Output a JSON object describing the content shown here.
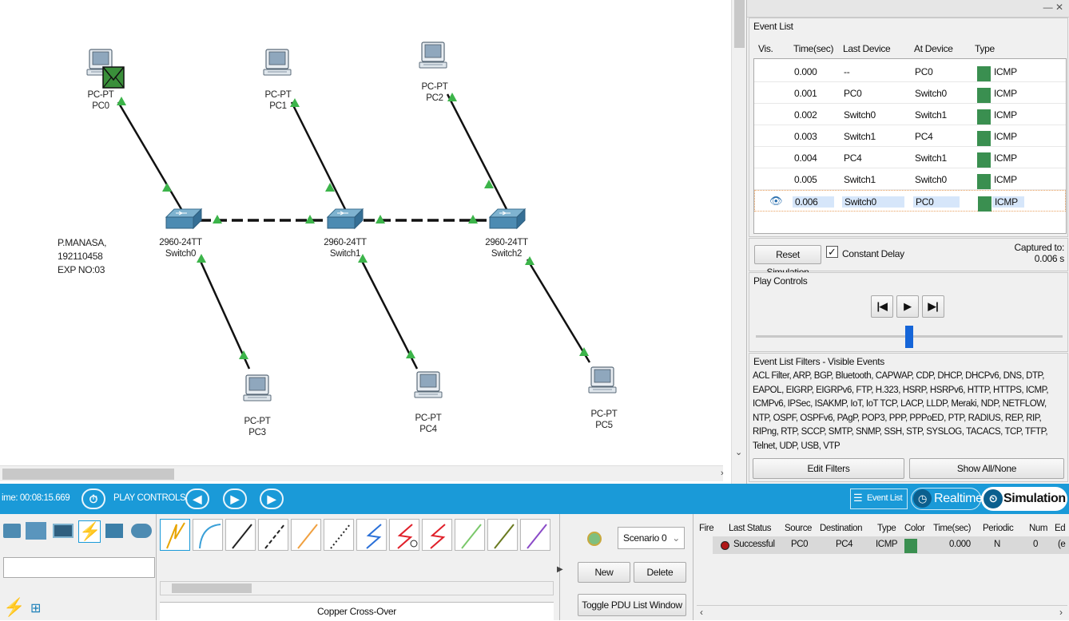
{
  "canvas": {
    "devices": [
      {
        "id": "pc0",
        "model": "PC-PT",
        "name": "PC0",
        "has_pdu": true
      },
      {
        "id": "pc1",
        "model": "PC-PT",
        "name": "PC1"
      },
      {
        "id": "pc2",
        "model": "PC-PT",
        "name": "PC2"
      },
      {
        "id": "pc3",
        "model": "PC-PT",
        "name": "PC3"
      },
      {
        "id": "pc4",
        "model": "PC-PT",
        "name": "PC4"
      },
      {
        "id": "pc5",
        "model": "PC-PT",
        "name": "PC5"
      },
      {
        "id": "sw0",
        "model": "2960-24TT",
        "name": "Switch0"
      },
      {
        "id": "sw1",
        "model": "2960-24TT",
        "name": "Switch1"
      },
      {
        "id": "sw2",
        "model": "2960-24TT",
        "name": "Switch2"
      }
    ],
    "note": [
      "P.MANASA,",
      "192110458",
      "EXP NO:03"
    ],
    "link_color": "#111111",
    "link_light_color": "#3cb44a"
  },
  "event_list": {
    "title": "Event List",
    "columns": [
      "Vis.",
      "Time(sec)",
      "Last Device",
      "At Device",
      "Type"
    ],
    "rows": [
      {
        "time": "0.000",
        "last": "--",
        "at": "PC0",
        "type": "ICMP"
      },
      {
        "time": "0.001",
        "last": "PC0",
        "at": "Switch0",
        "type": "ICMP"
      },
      {
        "time": "0.002",
        "last": "Switch0",
        "at": "Switch1",
        "type": "ICMP"
      },
      {
        "time": "0.003",
        "last": "Switch1",
        "at": "PC4",
        "type": "ICMP"
      },
      {
        "time": "0.004",
        "last": "PC4",
        "at": "Switch1",
        "type": "ICMP"
      },
      {
        "time": "0.005",
        "last": "Switch1",
        "at": "Switch0",
        "type": "ICMP"
      },
      {
        "time": "0.006",
        "last": "Switch0",
        "at": "PC0",
        "type": "ICMP",
        "selected": true
      }
    ],
    "icmp_color": "#3a8f50",
    "reset_label": "Reset Simulation",
    "constant_delay_label": "Constant Delay",
    "constant_delay_checked": true,
    "captured_label": "Captured to:",
    "captured_value": "0.006 s"
  },
  "play_controls": {
    "title": "Play Controls",
    "back_icon": "|◀",
    "play_icon": "▶",
    "forward_icon": "▶|",
    "slider_level": 0.5
  },
  "filters": {
    "title": "Event List Filters - Visible Events",
    "text": "ACL Filter, ARP, BGP, Bluetooth, CAPWAP, CDP, DHCP, DHCPv6, DNS, DTP, EAPOL, EIGRP, EIGRPv6, FTP, H.323, HSRP, HSRPv6, HTTP, HTTPS, ICMP, ICMPv6, IPSec, ISAKMP, IoT, IoT TCP, LACP, LLDP, Meraki, NDP, NETFLOW, NTP, OSPF, OSPFv6, PAgP, POP3, PPP, PPPoED, PTP, RADIUS, REP, RIP, RIPng, RTP, SCCP, SMTP, SNMP, SSH, STP, SYSLOG, TACACS, TCP, TFTP, Telnet, UDP, USB, VTP",
    "edit_label": "Edit Filters",
    "show_label": "Show All/None"
  },
  "statusbar": {
    "time": "ime: 00:08:15.669",
    "play_controls_label": "PLAY CONTROLS:",
    "event_list_label": "Event List",
    "realtime_label": "Realtime",
    "simulation_label": "Simulation",
    "accent": "#1a9ad8"
  },
  "bottom": {
    "cable_name": "Copper Cross-Over",
    "scenario": "Scenario 0",
    "new_label": "New",
    "delete_label": "Delete",
    "toggle_label": "Toggle PDU List Window",
    "pdu_columns": [
      "Fire",
      "Last Status",
      "Source",
      "Destination",
      "Type",
      "Color",
      "Time(sec)",
      "Periodic",
      "Num",
      "Ed"
    ],
    "pdu_row": {
      "status": "Successful",
      "source": "PC0",
      "destination": "PC4",
      "type": "ICMP",
      "time": "0.000",
      "periodic": "N",
      "num": "0",
      "edit": "(e"
    }
  }
}
